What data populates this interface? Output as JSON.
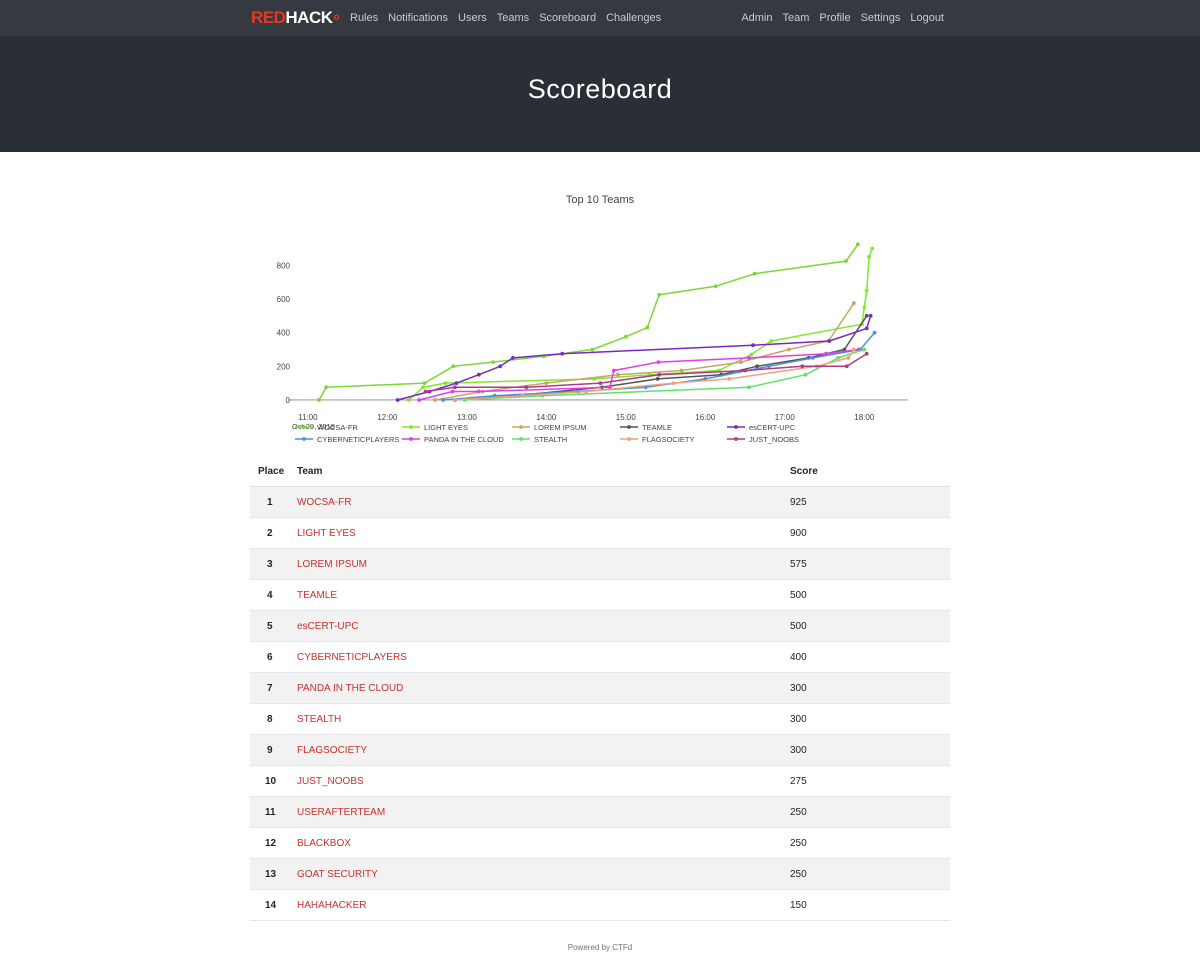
{
  "nav": {
    "brand_red": "RED",
    "brand_white": "HACK",
    "left_links": [
      "Rules",
      "Notifications",
      "Users",
      "Teams",
      "Scoreboard",
      "Challenges"
    ],
    "right_links": [
      "Admin",
      "Team",
      "Profile",
      "Settings",
      "Logout"
    ]
  },
  "header": {
    "title": "Scoreboard"
  },
  "chart_data": {
    "type": "line",
    "title": "Top 10 Teams",
    "x_axis": {
      "ticks": [
        "11:00",
        "12:00",
        "13:00",
        "14:00",
        "15:00",
        "16:00",
        "17:00",
        "18:00"
      ],
      "date_label": "Oct 29, 2019",
      "range_hours": [
        10.75,
        18.55
      ]
    },
    "y_axis": {
      "ticks": [
        0,
        200,
        400,
        600,
        800
      ],
      "range": [
        -30,
        980
      ]
    },
    "series": [
      {
        "name": "WOCSA-FR",
        "color": "#7cd636",
        "points": [
          [
            11.14,
            0
          ],
          [
            11.23,
            75
          ],
          [
            12.47,
            100
          ],
          [
            12.83,
            200
          ],
          [
            13.33,
            225
          ],
          [
            13.97,
            260
          ],
          [
            14.58,
            300
          ],
          [
            15.0,
            375
          ],
          [
            15.27,
            430
          ],
          [
            15.42,
            625
          ],
          [
            16.13,
            675
          ],
          [
            16.62,
            750
          ],
          [
            17.77,
            825
          ],
          [
            17.92,
            925
          ]
        ]
      },
      {
        "name": "LIGHT EYES",
        "color": "#7ee829",
        "points": [
          [
            12.27,
            0
          ],
          [
            12.45,
            75
          ],
          [
            12.73,
            100
          ],
          [
            14.6,
            125
          ],
          [
            15.3,
            150
          ],
          [
            16.17,
            175
          ],
          [
            16.58,
            270
          ],
          [
            16.83,
            350
          ],
          [
            17.97,
            450
          ],
          [
            18.0,
            550
          ],
          [
            18.03,
            650
          ],
          [
            18.06,
            850
          ],
          [
            18.1,
            900
          ]
        ]
      },
      {
        "name": "LOREM IPSUM",
        "color": "#c8a46a",
        "points": [
          [
            12.6,
            0
          ],
          [
            13.2,
            50
          ],
          [
            14.0,
            100
          ],
          [
            14.9,
            150
          ],
          [
            15.7,
            175
          ],
          [
            16.45,
            225
          ],
          [
            17.05,
            300
          ],
          [
            17.55,
            350
          ],
          [
            17.87,
            575
          ]
        ]
      },
      {
        "name": "TEAMLE",
        "color": "#555555",
        "points": [
          [
            12.85,
            0
          ],
          [
            13.6,
            25
          ],
          [
            14.7,
            75
          ],
          [
            15.4,
            125
          ],
          [
            16.2,
            150
          ],
          [
            16.65,
            200
          ],
          [
            17.3,
            250
          ],
          [
            17.75,
            300
          ],
          [
            18.03,
            500
          ]
        ]
      },
      {
        "name": "esCERT-UPC",
        "color": "#7a28c4",
        "points": [
          [
            12.13,
            0
          ],
          [
            12.53,
            50
          ],
          [
            12.87,
            100
          ],
          [
            13.15,
            150
          ],
          [
            13.42,
            200
          ],
          [
            13.58,
            250
          ],
          [
            14.2,
            275
          ],
          [
            16.6,
            325
          ],
          [
            17.56,
            350
          ],
          [
            18.03,
            425
          ],
          [
            18.08,
            500
          ]
        ]
      },
      {
        "name": "CYBERNETICPLAYERS",
        "color": "#4c8fe0",
        "points": [
          [
            12.7,
            0
          ],
          [
            13.35,
            25
          ],
          [
            14.4,
            50
          ],
          [
            15.25,
            75
          ],
          [
            16.0,
            125
          ],
          [
            16.8,
            200
          ],
          [
            17.35,
            250
          ],
          [
            17.95,
            300
          ],
          [
            18.13,
            400
          ]
        ]
      },
      {
        "name": "PANDA IN THE CLOUD",
        "color": "#e03fe8",
        "points": [
          [
            12.4,
            0
          ],
          [
            12.82,
            50
          ],
          [
            13.15,
            50
          ],
          [
            14.8,
            75
          ],
          [
            14.85,
            175
          ],
          [
            15.41,
            225
          ],
          [
            16.55,
            250
          ],
          [
            17.52,
            275
          ],
          [
            17.93,
            300
          ]
        ]
      },
      {
        "name": "STEALTH",
        "color": "#5fe36d",
        "points": [
          [
            12.97,
            0
          ],
          [
            13.95,
            25
          ],
          [
            16.55,
            75
          ],
          [
            17.26,
            150
          ],
          [
            17.67,
            250
          ],
          [
            18.0,
            300
          ]
        ]
      },
      {
        "name": "FLAGSOCIETY",
        "color": "#f0a277",
        "points": [
          [
            12.85,
            0
          ],
          [
            13.7,
            25
          ],
          [
            14.5,
            50
          ],
          [
            15.6,
            100
          ],
          [
            16.3,
            125
          ],
          [
            17.4,
            200
          ],
          [
            17.8,
            250
          ],
          [
            17.87,
            300
          ]
        ]
      },
      {
        "name": "JUST_NOOBS",
        "color": "#b03a86",
        "points": [
          [
            12.48,
            50
          ],
          [
            12.85,
            75
          ],
          [
            13.75,
            75
          ],
          [
            14.68,
            100
          ],
          [
            15.42,
            150
          ],
          [
            16.5,
            175
          ],
          [
            17.22,
            200
          ],
          [
            17.78,
            200
          ],
          [
            18.03,
            275
          ]
        ]
      }
    ]
  },
  "table": {
    "headers": {
      "place": "Place",
      "team": "Team",
      "score": "Score"
    },
    "rows": [
      {
        "place": "1",
        "team": "WOCSA-FR",
        "score": "925"
      },
      {
        "place": "2",
        "team": "LIGHT EYES",
        "score": "900"
      },
      {
        "place": "3",
        "team": "LOREM IPSUM",
        "score": "575"
      },
      {
        "place": "4",
        "team": "TEAMLE",
        "score": "500"
      },
      {
        "place": "5",
        "team": "esCERT-UPC",
        "score": "500"
      },
      {
        "place": "6",
        "team": "CYBERNETICPLAYERS",
        "score": "400"
      },
      {
        "place": "7",
        "team": "PANDA IN THE CLOUD",
        "score": "300"
      },
      {
        "place": "8",
        "team": "STEALTH",
        "score": "300"
      },
      {
        "place": "9",
        "team": "FLAGSOCIETY",
        "score": "300"
      },
      {
        "place": "10",
        "team": "JUST_NOOBS",
        "score": "275"
      },
      {
        "place": "11",
        "team": "USERAFTERTEAM",
        "score": "250"
      },
      {
        "place": "12",
        "team": "BLACKBOX",
        "score": "250"
      },
      {
        "place": "13",
        "team": "GOAT SECURITY",
        "score": "250"
      },
      {
        "place": "14",
        "team": "HAHAHACKER",
        "score": "150"
      }
    ]
  },
  "footer": {
    "text": "Powered by CTFd"
  }
}
